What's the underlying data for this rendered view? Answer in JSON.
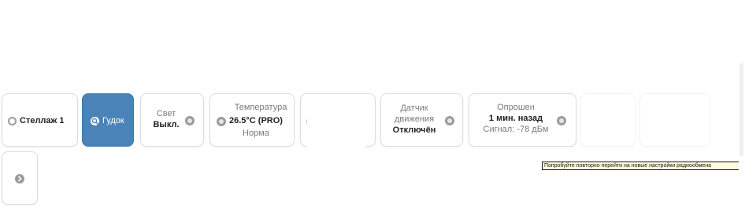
{
  "cards": {
    "rack": {
      "label": "Стеллаж 1"
    },
    "beep": {
      "label": "Гудок"
    },
    "light": {
      "title": "Свет",
      "value": "Выкл."
    },
    "temperature": {
      "title": "Температура",
      "value": "26.5°C (PRO)",
      "status": "Норма"
    },
    "motion": {
      "title_line1": "Датчик",
      "title_line2": "движения",
      "value": "Отключён"
    },
    "polled": {
      "title": "Опрошен",
      "value": "1 мин. назад",
      "signal": "Сигнал: -78 дБм"
    }
  },
  "tooltip": {
    "text": "Попробуйте повторно перейти на новые настройки радиообмена"
  },
  "colors": {
    "primary": "#4a83b8",
    "border": "#dcdcdc",
    "icon_grey": "#9b9b9b"
  },
  "icons": {
    "rack": "ring-icon",
    "beep": "search-icon",
    "light": "status-dot-icon",
    "temperature": "status-dot-icon",
    "motion": "status-dot-icon",
    "polled": "status-dot-icon",
    "next": "chevron-right-icon"
  }
}
